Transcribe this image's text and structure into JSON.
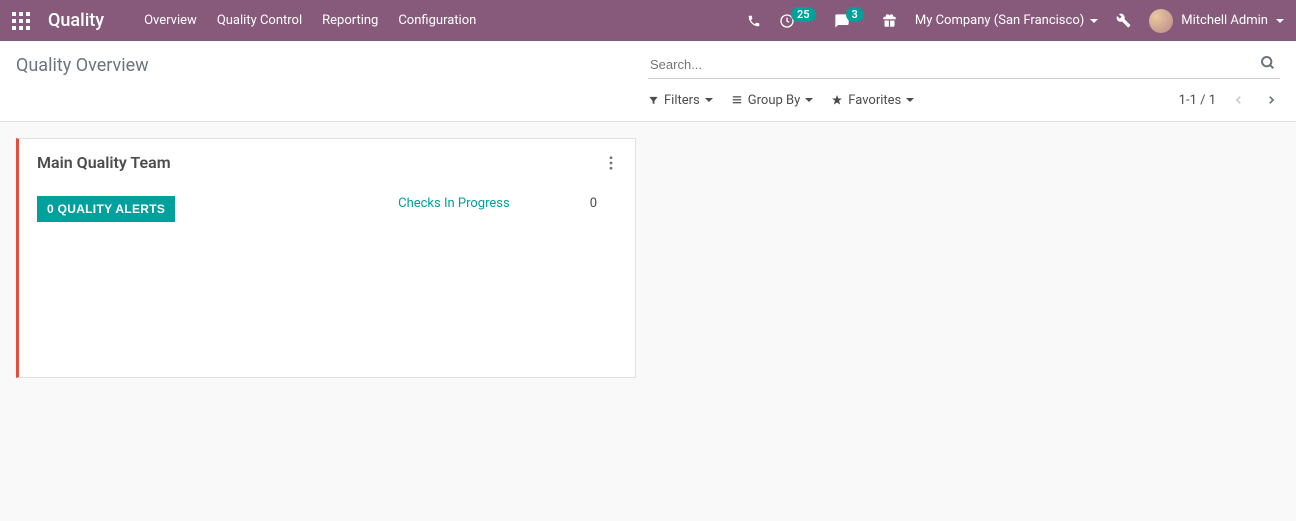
{
  "navbar": {
    "brand": "Quality",
    "menu": [
      "Overview",
      "Quality Control",
      "Reporting",
      "Configuration"
    ],
    "activity_count": "25",
    "messages_count": "3",
    "company": "My Company (San Francisco)",
    "user": "Mitchell Admin"
  },
  "control_panel": {
    "breadcrumb": "Quality Overview",
    "search_placeholder": "Search...",
    "filters_label": "Filters",
    "groupby_label": "Group By",
    "favorites_label": "Favorites",
    "pager": "1-1 / 1"
  },
  "kanban": {
    "team_name": "Main Quality Team",
    "alerts_button": "0 QUALITY ALERTS",
    "checks_label": "Checks In Progress",
    "checks_count": "0"
  }
}
